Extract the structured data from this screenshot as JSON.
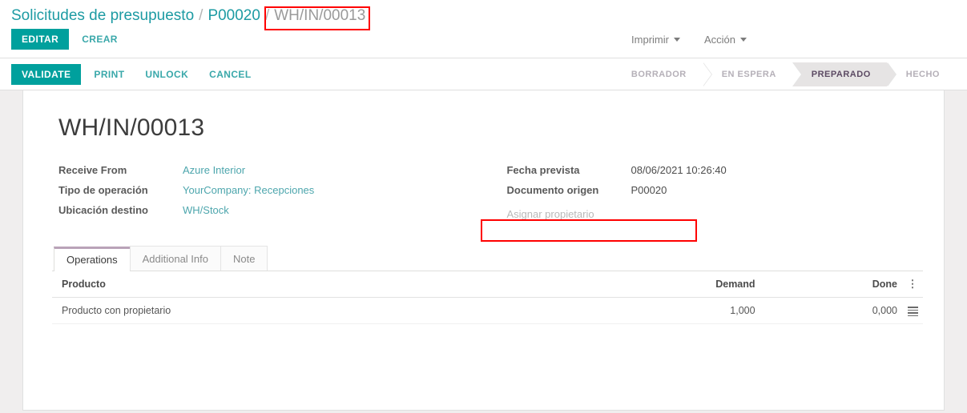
{
  "breadcrumb": {
    "items": [
      {
        "label": "Solicitudes de presupuesto",
        "current": false
      },
      {
        "label": "P00020",
        "current": false
      },
      {
        "label": "WH/IN/00013",
        "current": true
      }
    ],
    "separator": "/"
  },
  "control_panel": {
    "edit_label": "EDITAR",
    "create_label": "CREAR",
    "print_label": "Imprimir",
    "action_label": "Acción"
  },
  "statusbar_buttons": {
    "validate_label": "VALIDATE",
    "print_label": "PRINT",
    "unlock_label": "UNLOCK",
    "cancel_label": "CANCEL"
  },
  "stages": [
    {
      "label": "BORRADOR",
      "active": false
    },
    {
      "label": "EN ESPERA",
      "active": false
    },
    {
      "label": "PREPARADO",
      "active": true
    },
    {
      "label": "HECHO",
      "active": false
    }
  ],
  "document": {
    "title": "WH/IN/00013",
    "fields_left": [
      {
        "label": "Receive From",
        "value": "Azure Interior",
        "type": "link"
      },
      {
        "label": "Tipo de operación",
        "value": "YourCompany: Recepciones",
        "type": "link"
      },
      {
        "label": "Ubicación destino",
        "value": "WH/Stock",
        "type": "link"
      }
    ],
    "fields_right": [
      {
        "label": "Fecha prevista",
        "value": "08/06/2021 10:26:40",
        "type": "text"
      },
      {
        "label": "Documento origen",
        "value": "P00020",
        "type": "text"
      }
    ],
    "owner_field": {
      "placeholder": "Asignar propietario",
      "value": ""
    }
  },
  "tabs": [
    {
      "label": "Operations",
      "active": true
    },
    {
      "label": "Additional Info",
      "active": false
    },
    {
      "label": "Note",
      "active": false
    }
  ],
  "operations_table": {
    "columns": [
      "Producto",
      "Demand",
      "Done"
    ],
    "options_icon": "vertical-dots-icon",
    "rows": [
      {
        "product": "Producto con propietario",
        "demand": "1,000",
        "done": "0,000",
        "detail_icon": "list-lines-icon"
      }
    ]
  },
  "colors": {
    "primary": "#00a09d",
    "link": "#4da6ad",
    "annotation": "#ff0000",
    "active_stage_text": "#5c4a63",
    "tab_accent": "#b9a2b8"
  }
}
